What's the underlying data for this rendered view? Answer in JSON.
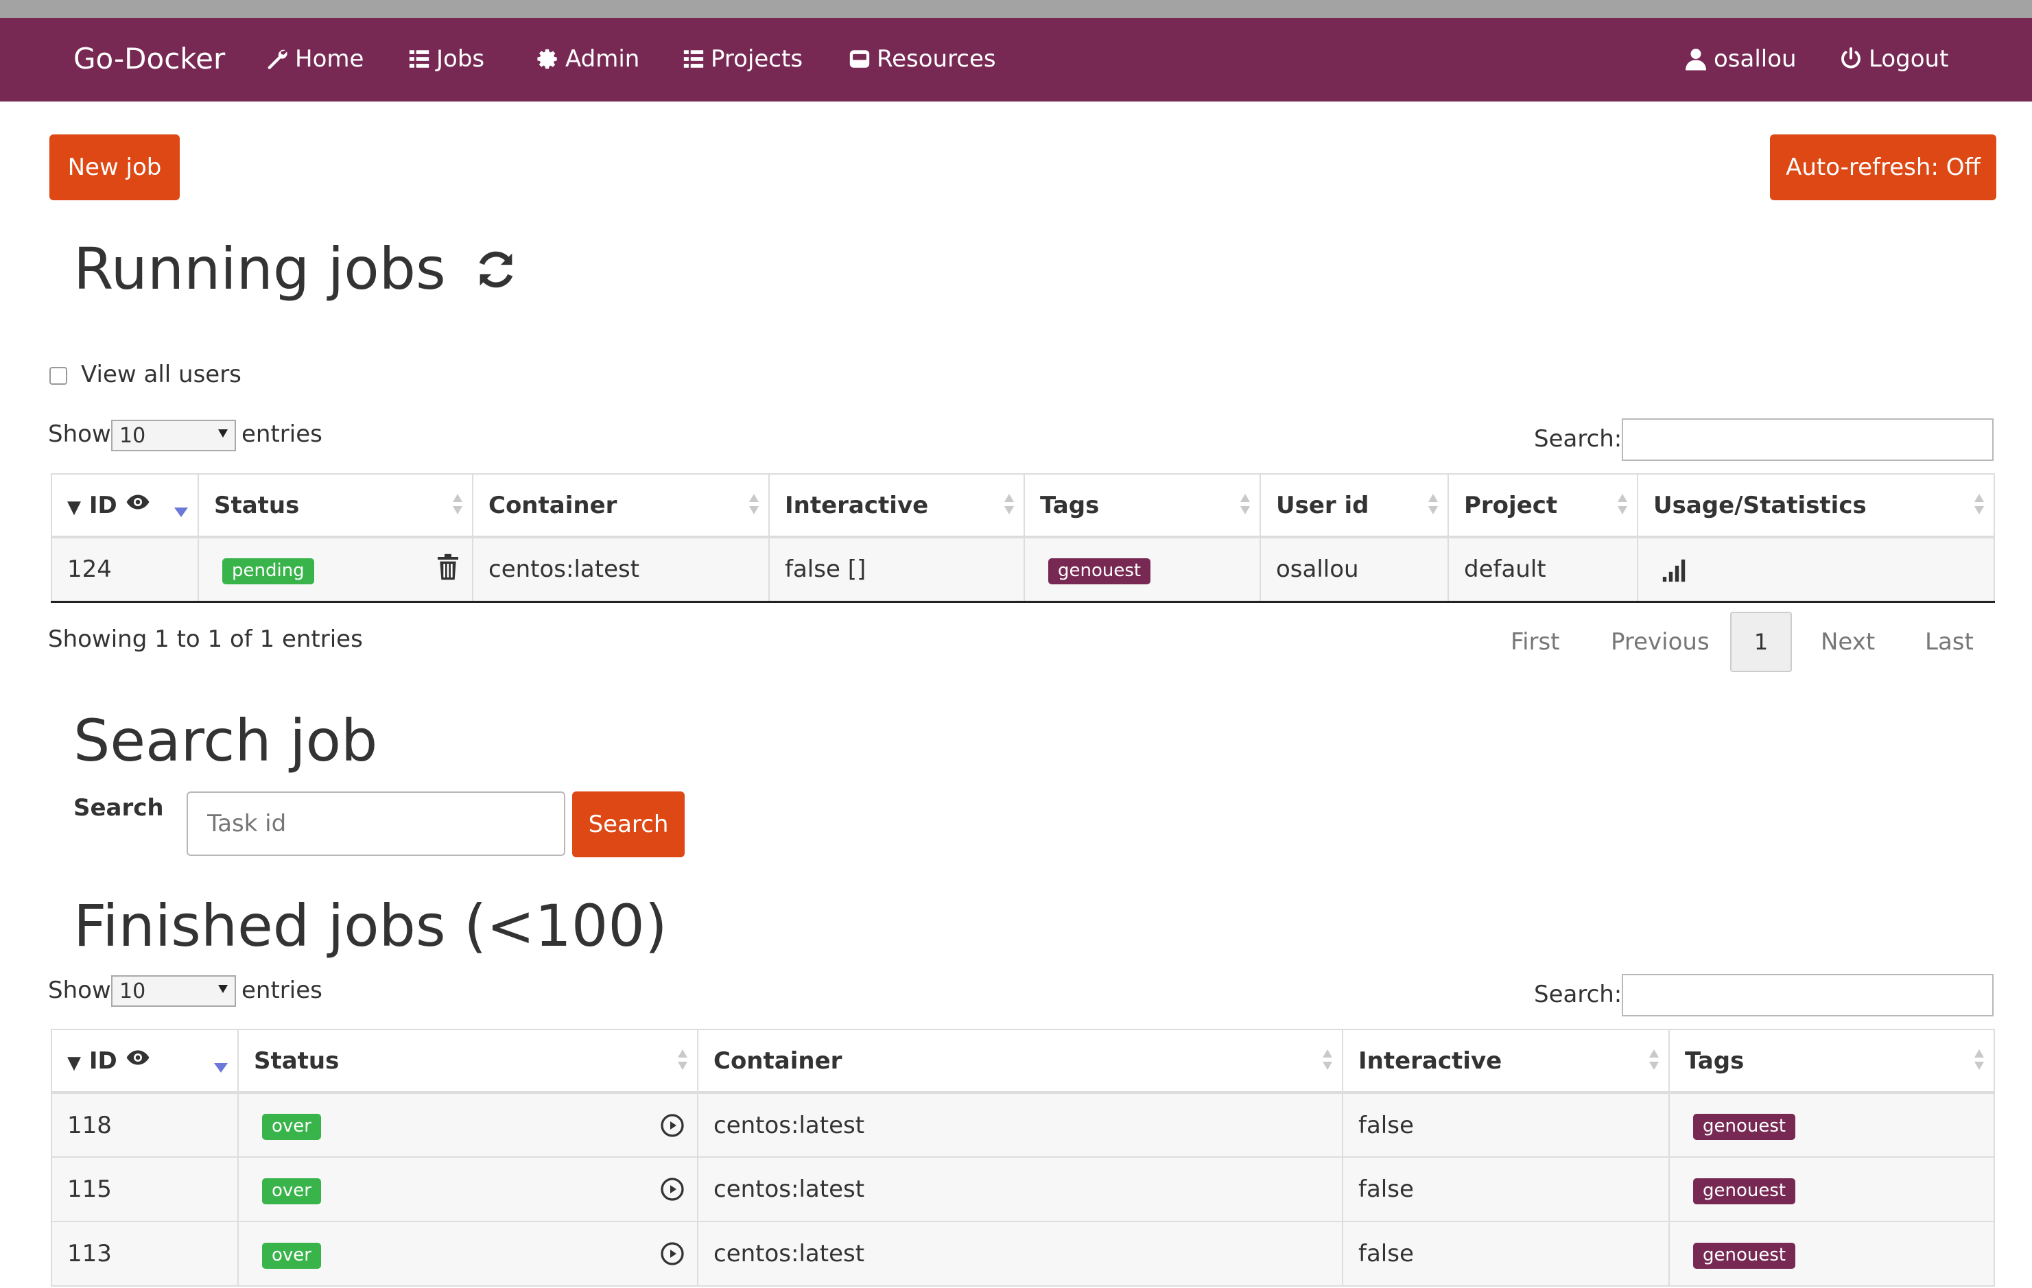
{
  "nav": {
    "brand": "Go-Docker",
    "items": [
      {
        "label": "Home",
        "icon": "wrench-icon"
      },
      {
        "label": "Jobs",
        "icon": "list-icon"
      },
      {
        "label": "Admin",
        "icon": "gear-icon"
      },
      {
        "label": "Projects",
        "icon": "list-icon"
      },
      {
        "label": "Resources",
        "icon": "hdd-icon"
      }
    ],
    "user": {
      "label": "osallou",
      "icon": "user-icon"
    },
    "logout": {
      "label": "Logout",
      "icon": "power-icon"
    }
  },
  "toolbar": {
    "new_job": "New job",
    "auto_refresh": "Auto-refresh: Off"
  },
  "running": {
    "title": "Running jobs",
    "view_all_users": "View all users",
    "show_label": "Show",
    "page_size": "10",
    "entries_label": "entries",
    "search_label": "Search:",
    "headers": [
      "ID",
      "Status",
      "Container",
      "Interactive",
      "Tags",
      "User id",
      "Project",
      "Usage/Statistics"
    ],
    "rows": [
      {
        "id": "124",
        "status": "pending",
        "container": "centos:latest",
        "interactive": "false []",
        "tag": "genouest",
        "user": "osallou",
        "project": "default"
      }
    ],
    "info": "Showing 1 to 1 of 1 entries",
    "pager": {
      "first": "First",
      "previous": "Previous",
      "current": "1",
      "next": "Next",
      "last": "Last"
    }
  },
  "search_job": {
    "title": "Search job",
    "label": "Search",
    "placeholder": "Task id",
    "button": "Search"
  },
  "finished": {
    "title": "Finished jobs (<100)",
    "show_label": "Show",
    "page_size": "10",
    "entries_label": "entries",
    "search_label": "Search:",
    "headers": [
      "ID",
      "Status",
      "Container",
      "Interactive",
      "Tags"
    ],
    "rows": [
      {
        "id": "118",
        "status": "over",
        "container": "centos:latest",
        "interactive": "false",
        "tag": "genouest"
      },
      {
        "id": "115",
        "status": "over",
        "container": "centos:latest",
        "interactive": "false",
        "tag": "genouest"
      },
      {
        "id": "113",
        "status": "over",
        "container": "centos:latest",
        "interactive": "false",
        "tag": "genouest"
      }
    ]
  },
  "colors": {
    "navbar": "#772953",
    "accent": "#dd4814",
    "label_green": "#38b44a",
    "label_purple": "#772953"
  }
}
